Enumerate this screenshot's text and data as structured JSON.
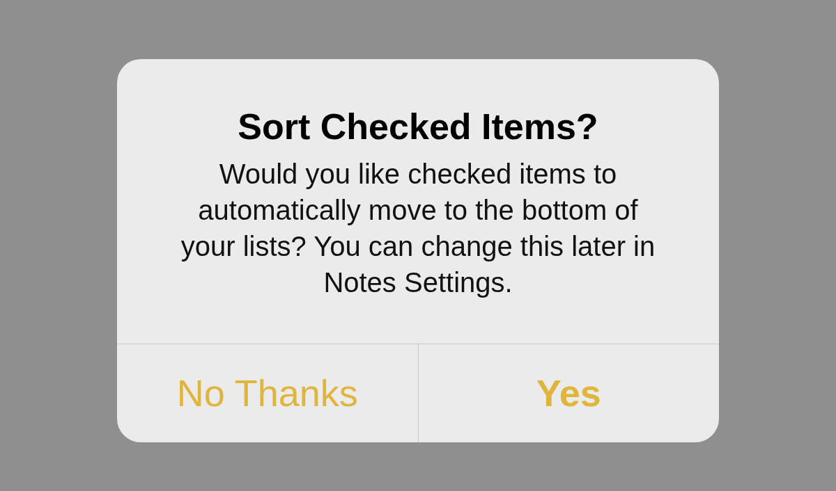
{
  "alert": {
    "title": "Sort Checked Items?",
    "message": "Would you like checked items to automatically move to the bottom of your lists? You can change this later in Notes Settings.",
    "buttons": [
      {
        "label": "No Thanks",
        "kind": "cancel"
      },
      {
        "label": "Yes",
        "kind": "default"
      }
    ]
  }
}
